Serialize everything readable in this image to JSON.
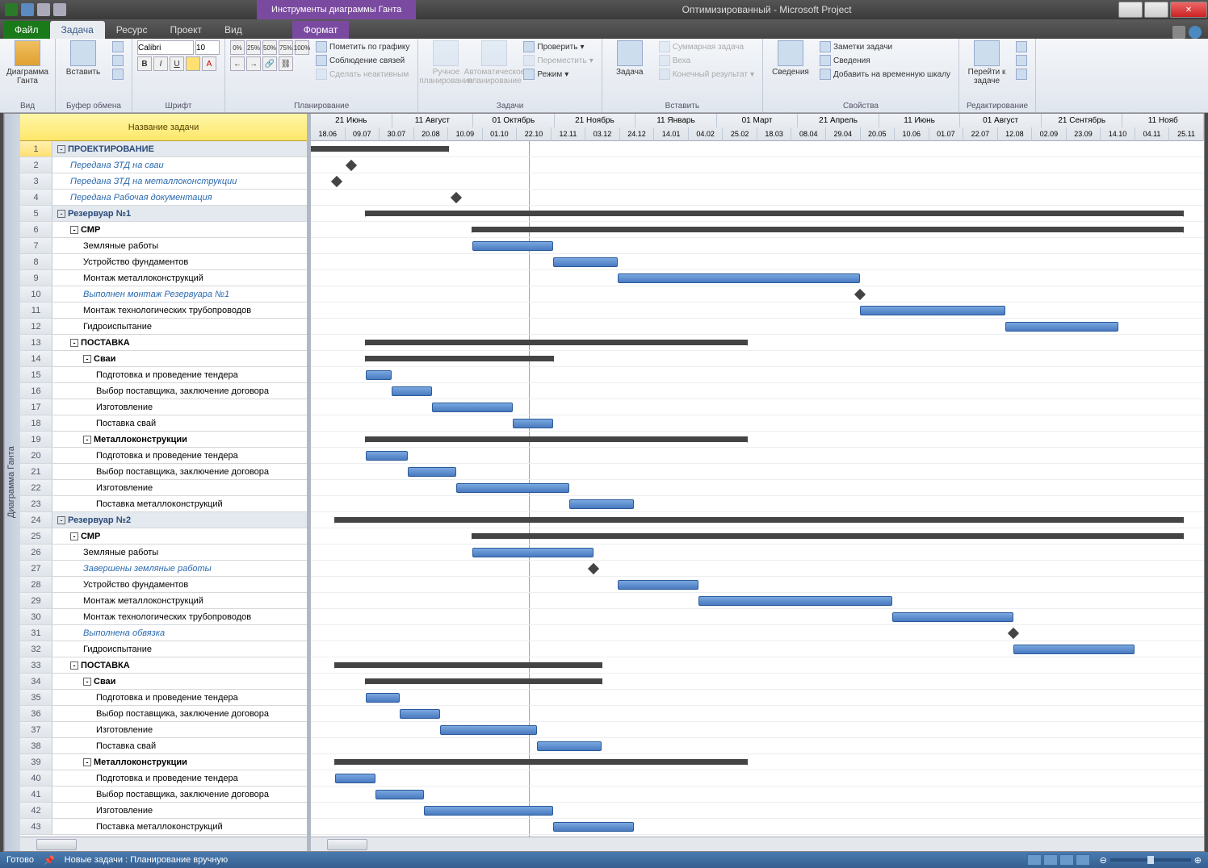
{
  "app": {
    "title_tool": "Инструменты диаграммы Ганта",
    "doc_title": "Оптимизированный - Microsoft Project"
  },
  "menu": {
    "file": "Файл",
    "tabs": [
      "Задача",
      "Ресурс",
      "Проект",
      "Вид"
    ],
    "format": "Формат"
  },
  "ribbon": {
    "g1": {
      "btn": "Диаграмма Ганта",
      "label": "Вид"
    },
    "g2": {
      "btn": "Вставить",
      "label": "Буфер обмена"
    },
    "g3": {
      "font": "Calibri",
      "size": "10",
      "label": "Шрифт"
    },
    "g4": {
      "mark": "Пометить по графику",
      "links": "Соблюдение связей",
      "inactive": "Сделать неактивным",
      "label": "Планирование"
    },
    "g5": {
      "manual": "Ручное планирование",
      "auto": "Автоматическое планирование",
      "check": "Проверить",
      "move": "Переместить",
      "mode": "Режим",
      "label": "Задачи"
    },
    "g6": {
      "task": "Задача",
      "sum": "Суммарная задача",
      "veha": "Веха",
      "result": "Конечный результат",
      "label": "Вставить"
    },
    "g7": {
      "info": "Сведения",
      "notes": "Заметки задачи",
      "details": "Сведения",
      "timeline": "Добавить на временную шкалу",
      "label": "Свойства"
    },
    "g8": {
      "scroll": "Перейти к задаче",
      "label": "Редактирование"
    }
  },
  "grid": {
    "header": "Название задачи",
    "sidebar": "Диаграмма Ганта"
  },
  "timeline": {
    "major": [
      "21 Июнь",
      "11 Август",
      "01 Октябрь",
      "21 Ноябрь",
      "11 Январь",
      "01 Март",
      "21 Апрель",
      "11 Июнь",
      "01 Август",
      "21 Сентябрь",
      "11 Нояб"
    ],
    "minor": [
      "18.06",
      "09.07",
      "30.07",
      "20.08",
      "10.09",
      "01.10",
      "22.10",
      "12.11",
      "03.12",
      "24.12",
      "14.01",
      "04.02",
      "25.02",
      "18.03",
      "08.04",
      "29.04",
      "20.05",
      "10.06",
      "01.07",
      "22.07",
      "12.08",
      "02.09",
      "23.09",
      "14.10",
      "04.11",
      "25.11"
    ]
  },
  "tasks": [
    {
      "n": 1,
      "name": "ПРОЕКТИРОВАНИЕ",
      "lvl": 0,
      "type": "sum",
      "s": 0,
      "e": 170,
      "head": true
    },
    {
      "n": 2,
      "name": "Передана ЗТД на сваи",
      "lvl": 1,
      "type": "ms",
      "at": 50
    },
    {
      "n": 3,
      "name": "Передана ЗТД на металлоконструкции",
      "lvl": 1,
      "type": "ms",
      "at": 32
    },
    {
      "n": 4,
      "name": "Передана Рабочая документация",
      "lvl": 1,
      "type": "ms",
      "at": 180
    },
    {
      "n": 5,
      "name": "Резервуар №1",
      "lvl": 0,
      "type": "sum",
      "s": 68,
      "e": 1080,
      "head": true
    },
    {
      "n": 6,
      "name": "СМР",
      "lvl": 1,
      "type": "sum",
      "s": 200,
      "e": 1080
    },
    {
      "n": 7,
      "name": "Земляные работы",
      "lvl": 2,
      "type": "bar",
      "s": 200,
      "e": 300
    },
    {
      "n": 8,
      "name": "Устройство фундаментов",
      "lvl": 2,
      "type": "bar",
      "s": 300,
      "e": 380
    },
    {
      "n": 9,
      "name": "Монтаж металлоконструкций",
      "lvl": 2,
      "type": "bar",
      "s": 380,
      "e": 680
    },
    {
      "n": 10,
      "name": "Выполнен монтаж Резервуара №1",
      "lvl": 2,
      "type": "ms",
      "at": 680
    },
    {
      "n": 11,
      "name": "Монтаж технологических трубопроводов",
      "lvl": 2,
      "type": "bar",
      "s": 680,
      "e": 860
    },
    {
      "n": 12,
      "name": "Гидроиспытание",
      "lvl": 2,
      "type": "bar",
      "s": 860,
      "e": 1000
    },
    {
      "n": 13,
      "name": "ПОСТАВКА",
      "lvl": 1,
      "type": "sum",
      "s": 68,
      "e": 540
    },
    {
      "n": 14,
      "name": "Сваи",
      "lvl": 2,
      "type": "sum",
      "s": 68,
      "e": 300
    },
    {
      "n": 15,
      "name": "Подготовка и проведение тендера",
      "lvl": 3,
      "type": "bar",
      "s": 68,
      "e": 100
    },
    {
      "n": 16,
      "name": "Выбор поставщика, заключение договора",
      "lvl": 3,
      "type": "bar",
      "s": 100,
      "e": 150
    },
    {
      "n": 17,
      "name": "Изготовление",
      "lvl": 3,
      "type": "bar",
      "s": 150,
      "e": 250
    },
    {
      "n": 18,
      "name": "Поставка свай",
      "lvl": 3,
      "type": "bar",
      "s": 250,
      "e": 300
    },
    {
      "n": 19,
      "name": "Металлоконструкции",
      "lvl": 2,
      "type": "sum",
      "s": 68,
      "e": 540
    },
    {
      "n": 20,
      "name": "Подготовка и проведение тендера",
      "lvl": 3,
      "type": "bar",
      "s": 68,
      "e": 120
    },
    {
      "n": 21,
      "name": "Выбор поставщика, заключение договора",
      "lvl": 3,
      "type": "bar",
      "s": 120,
      "e": 180
    },
    {
      "n": 22,
      "name": "Изготовление",
      "lvl": 3,
      "type": "bar",
      "s": 180,
      "e": 320
    },
    {
      "n": 23,
      "name": "Поставка металлоконструкций",
      "lvl": 3,
      "type": "bar",
      "s": 320,
      "e": 400
    },
    {
      "n": 24,
      "name": "Резервуар №2",
      "lvl": 0,
      "type": "sum",
      "s": 30,
      "e": 1080,
      "head": true
    },
    {
      "n": 25,
      "name": "СМР",
      "lvl": 1,
      "type": "sum",
      "s": 200,
      "e": 1080
    },
    {
      "n": 26,
      "name": "Земляные работы",
      "lvl": 2,
      "type": "bar",
      "s": 200,
      "e": 350
    },
    {
      "n": 27,
      "name": "Завершены земляные работы",
      "lvl": 2,
      "type": "ms",
      "at": 350
    },
    {
      "n": 28,
      "name": "Устройство фундаментов",
      "lvl": 2,
      "type": "bar",
      "s": 380,
      "e": 480
    },
    {
      "n": 29,
      "name": "Монтаж металлоконструкций",
      "lvl": 2,
      "type": "bar",
      "s": 480,
      "e": 720
    },
    {
      "n": 30,
      "name": "Монтаж технологических трубопроводов",
      "lvl": 2,
      "type": "bar",
      "s": 720,
      "e": 870
    },
    {
      "n": 31,
      "name": "Выполнена обвязка",
      "lvl": 2,
      "type": "ms",
      "at": 870
    },
    {
      "n": 32,
      "name": "Гидроиспытание",
      "lvl": 2,
      "type": "bar",
      "s": 870,
      "e": 1020
    },
    {
      "n": 33,
      "name": "ПОСТАВКА",
      "lvl": 1,
      "type": "sum",
      "s": 30,
      "e": 360
    },
    {
      "n": 34,
      "name": "Сваи",
      "lvl": 2,
      "type": "sum",
      "s": 68,
      "e": 360
    },
    {
      "n": 35,
      "name": "Подготовка и проведение тендера",
      "lvl": 3,
      "type": "bar",
      "s": 68,
      "e": 110
    },
    {
      "n": 36,
      "name": "Выбор поставщика, заключение договора",
      "lvl": 3,
      "type": "bar",
      "s": 110,
      "e": 160
    },
    {
      "n": 37,
      "name": "Изготовление",
      "lvl": 3,
      "type": "bar",
      "s": 160,
      "e": 280
    },
    {
      "n": 38,
      "name": "Поставка свай",
      "lvl": 3,
      "type": "bar",
      "s": 280,
      "e": 360
    },
    {
      "n": 39,
      "name": "Металлоконструкции",
      "lvl": 2,
      "type": "sum",
      "s": 30,
      "e": 540
    },
    {
      "n": 40,
      "name": "Подготовка и проведение тендера",
      "lvl": 3,
      "type": "bar",
      "s": 30,
      "e": 80
    },
    {
      "n": 41,
      "name": "Выбор поставщика, заключение договора",
      "lvl": 3,
      "type": "bar",
      "s": 80,
      "e": 140
    },
    {
      "n": 42,
      "name": "Изготовление",
      "lvl": 3,
      "type": "bar",
      "s": 140,
      "e": 300
    },
    {
      "n": 43,
      "name": "Поставка металлоконструкций",
      "lvl": 3,
      "type": "bar",
      "s": 300,
      "e": 400
    }
  ],
  "status": {
    "ready": "Готово",
    "newtasks": "Новые задачи : Планирование вручную"
  }
}
